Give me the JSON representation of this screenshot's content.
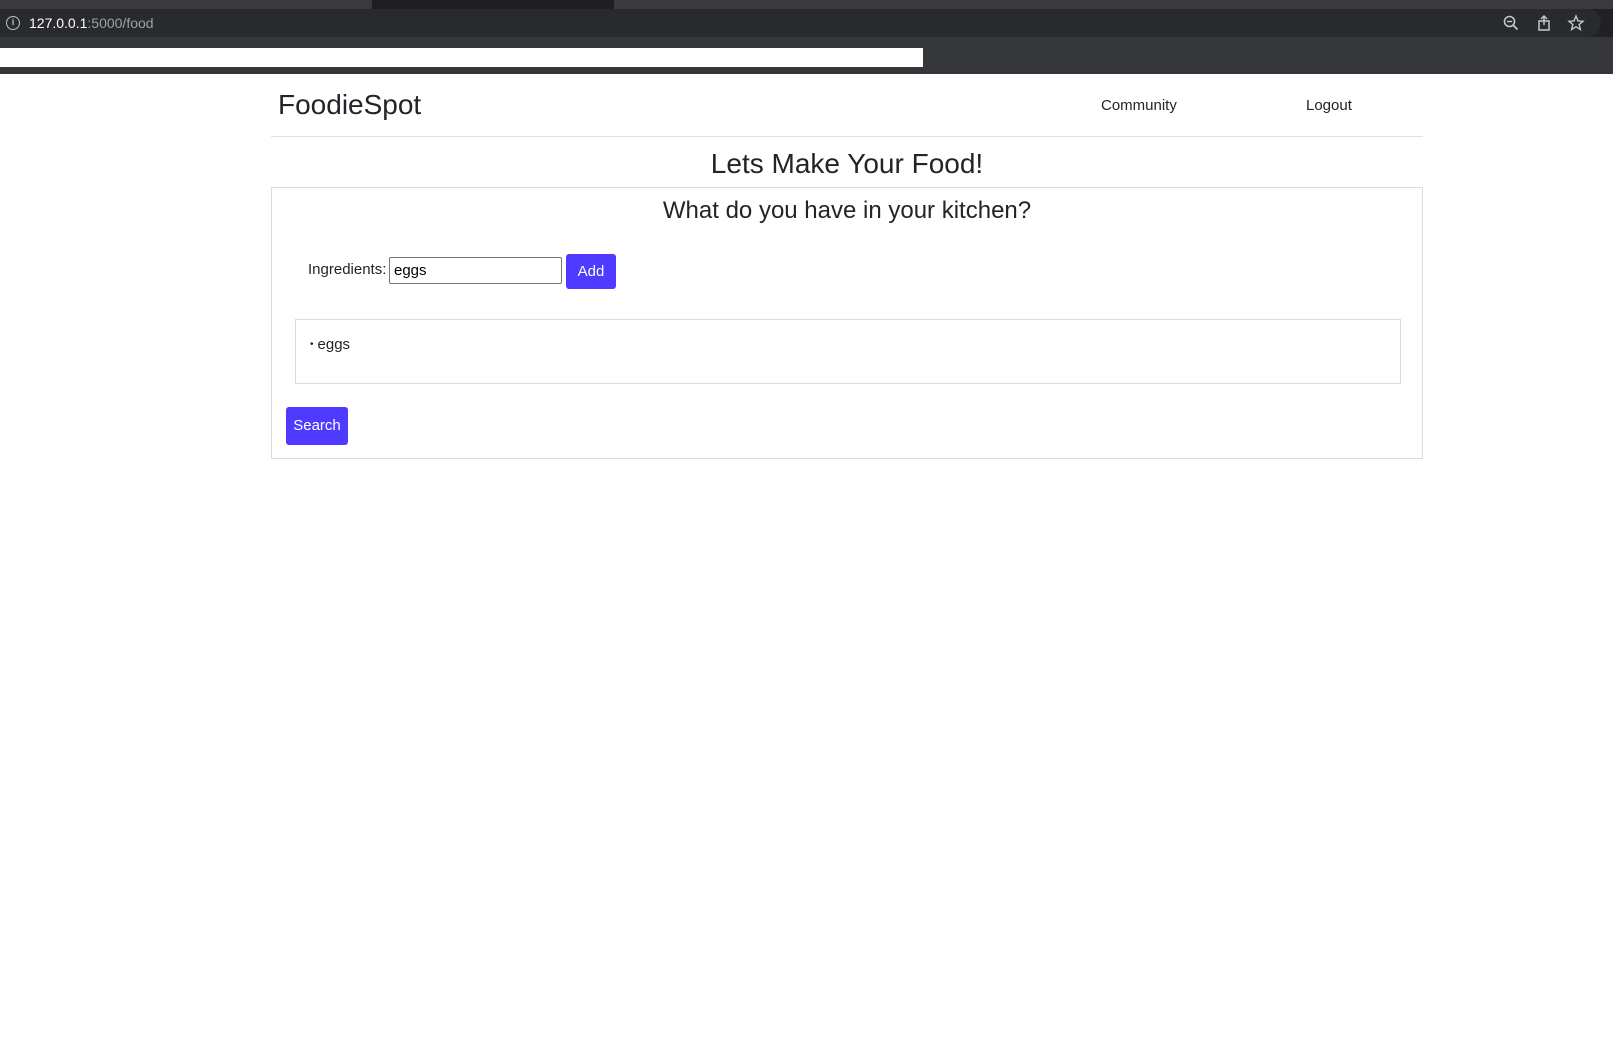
{
  "browser": {
    "url_host": "127.0.0.1",
    "url_path": ":5000/food",
    "icons": [
      "info-icon",
      "zoom-icon",
      "share-icon",
      "bookmark-star-icon"
    ]
  },
  "navbar": {
    "brand": "FoodieSpot",
    "links": [
      "Community",
      "Logout"
    ]
  },
  "main": {
    "title": "Lets Make Your Food!",
    "card": {
      "title": "What do you have in your kitchen?",
      "ingredients_label": "Ingredients:",
      "ingredients_value": "eggs",
      "add_label": "Add",
      "items": [
        "eggs"
      ],
      "search_label": "Search"
    }
  },
  "colors": {
    "primary_button": "#4f3bff",
    "text": "#212529"
  }
}
